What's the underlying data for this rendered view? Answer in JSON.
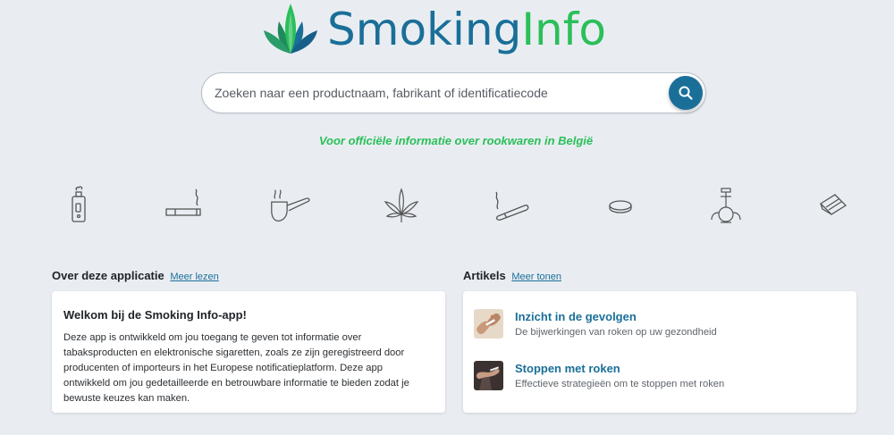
{
  "brand": {
    "part1": "Smoking",
    "part2": "Info"
  },
  "search": {
    "placeholder": "Zoeken naar een productnaam, fabrikant of identificatiecode"
  },
  "tagline": "Voor officiële informatie over rookwaren in België",
  "categories": [
    {
      "icon": "e-cigarette-icon"
    },
    {
      "icon": "cigarette-icon"
    },
    {
      "icon": "pipe-icon"
    },
    {
      "icon": "cannabis-leaf-icon"
    },
    {
      "icon": "cigar-icon"
    },
    {
      "icon": "nicotine-pouch-icon"
    },
    {
      "icon": "waterpipe-icon"
    },
    {
      "icon": "rolling-tobacco-icon"
    }
  ],
  "about": {
    "title": "Over deze applicatie",
    "link": "Meer lezen",
    "card_title": "Welkom bij de Smoking Info-app!",
    "card_text": "Deze app is ontwikkeld om jou toegang te geven tot informatie over tabaksproducten en elektronische sigaretten, zoals ze zijn geregistreerd door producenten of importeurs in het Europese notificatieplatform. Deze app ontwikkeld om jou gedetailleerde en betrouwbare informatie te bieden zodat je bewuste keuzes kan maken."
  },
  "articles": {
    "title": "Artikels",
    "link": "Meer tonen",
    "items": [
      {
        "title": "Inzicht in de gevolgen",
        "subtitle": "De bijwerkingen van roken op uw gezondheid"
      },
      {
        "title": "Stoppen met roken",
        "subtitle": "Effectieve strategieën om te stoppen met roken"
      }
    ]
  },
  "colors": {
    "brand_blue": "#1a6f98",
    "brand_green": "#2bbf59",
    "background": "#e9edf2"
  }
}
